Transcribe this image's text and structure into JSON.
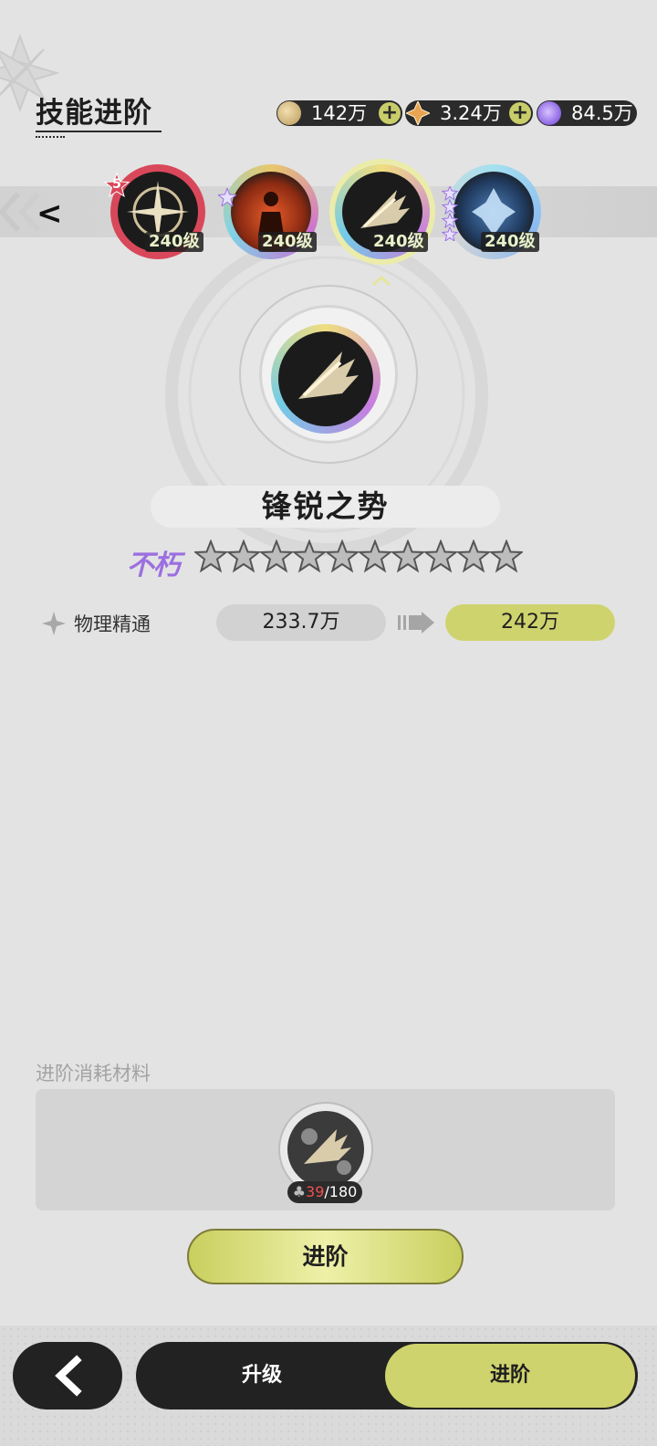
{
  "header": {
    "title": "技能进阶"
  },
  "currencies": [
    {
      "icon": "gold-coin-icon",
      "value": "142万"
    },
    {
      "icon": "star-crystal-icon",
      "value": "3.24万"
    },
    {
      "icon": "purple-gem-icon",
      "value": "84.5万"
    }
  ],
  "skills": [
    {
      "icon": "crosshair-skill-icon",
      "level": "240级",
      "stars": "5"
    },
    {
      "icon": "fire-figure-skill-icon",
      "level": "240级"
    },
    {
      "icon": "claw-strike-skill-icon",
      "level": "240级",
      "selected": true
    },
    {
      "icon": "ice-crystal-skill-icon",
      "level": "240级"
    }
  ],
  "detail": {
    "name": "锋锐之势",
    "rank": "不朽",
    "star_count": 10,
    "stars_filled": 0
  },
  "stat": {
    "label": "物理精通",
    "current": "233.7万",
    "next": "242万"
  },
  "materials": {
    "label": "进阶消耗材料",
    "have": "39",
    "need": "/180"
  },
  "actions": {
    "advance": "进阶"
  },
  "nav": {
    "upgrade": "升级",
    "advance": "进阶"
  },
  "colors": {
    "accent": "#cfd36e",
    "rank": "#9c6fe0",
    "badge": "#d9485a",
    "dark": "#222222"
  }
}
